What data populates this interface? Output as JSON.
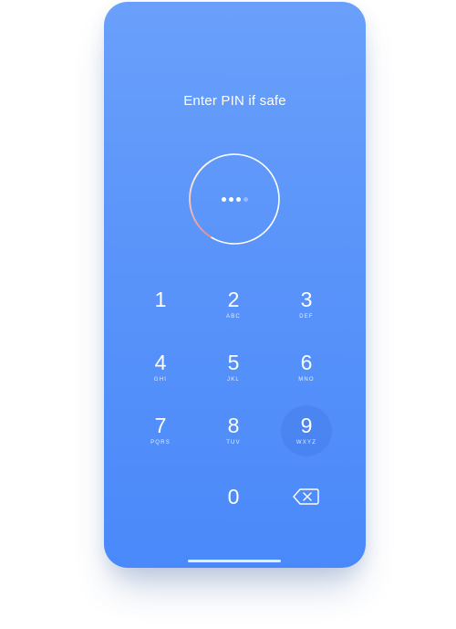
{
  "screen": {
    "prompt": "Enter PIN if safe"
  },
  "pin": {
    "length": 4,
    "entered": 3,
    "progress_ring_fraction": 0.32,
    "colors": {
      "ring": "#ffffff",
      "progress_arc": "#f0867e",
      "background_top": "#6aa0fb",
      "background_bottom": "#4a89fa",
      "active_key": "#3f7ee8"
    }
  },
  "keypad": {
    "keys": [
      {
        "digit": "1",
        "letters": ""
      },
      {
        "digit": "2",
        "letters": "ABC"
      },
      {
        "digit": "3",
        "letters": "DEF"
      },
      {
        "digit": "4",
        "letters": "GHI"
      },
      {
        "digit": "5",
        "letters": "JKL"
      },
      {
        "digit": "6",
        "letters": "MNO"
      },
      {
        "digit": "7",
        "letters": "PQRS"
      },
      {
        "digit": "8",
        "letters": "TUV"
      },
      {
        "digit": "9",
        "letters": "WXYZ"
      },
      {
        "digit": "0",
        "letters": ""
      }
    ],
    "pressed_key": "9",
    "backspace_icon": "backspace-icon"
  }
}
